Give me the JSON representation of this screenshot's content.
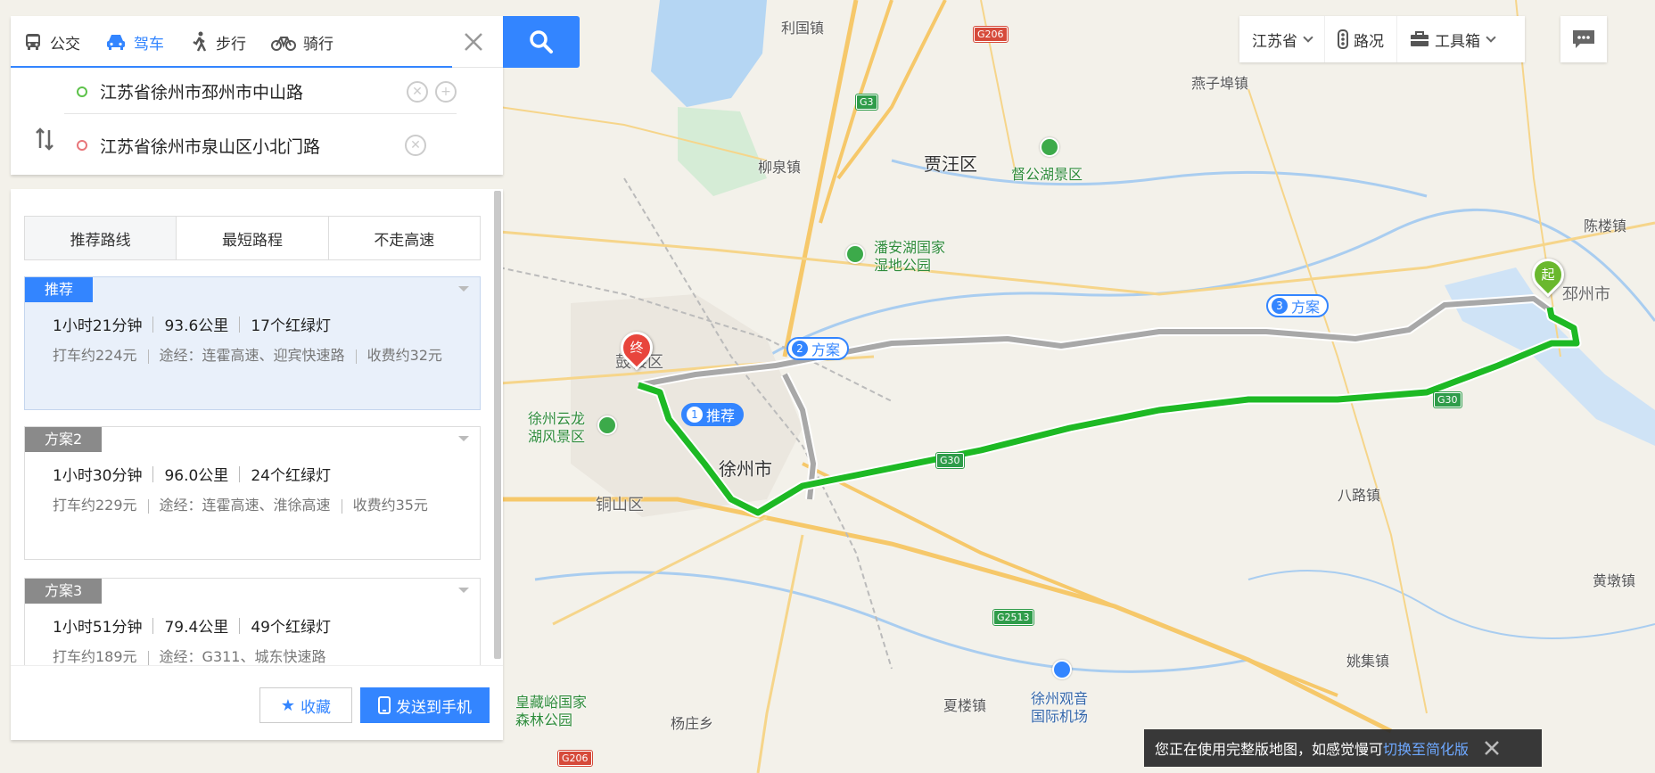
{
  "search": {
    "tabs": [
      {
        "label": "公交",
        "icon": "bus-icon"
      },
      {
        "label": "驾车",
        "icon": "car-icon"
      },
      {
        "label": "步行",
        "icon": "walk-icon"
      },
      {
        "label": "骑行",
        "icon": "bike-icon"
      }
    ],
    "active_tab": "驾车",
    "origin": "江苏省徐州市邳州市中山路",
    "destination": "江苏省徐州市泉山区小北门路"
  },
  "route_options": [
    "推荐路线",
    "最短路程",
    "不走高速"
  ],
  "plans": [
    {
      "badge": "推荐",
      "time": "1小时21分钟",
      "distance": "93.6公里",
      "lights": "17个红绿灯",
      "taxi": "打车约224元",
      "via": "途经：连霍高速、迎宾快速路",
      "toll": "收费约32元"
    },
    {
      "badge": "方案2",
      "time": "1小时30分钟",
      "distance": "96.0公里",
      "lights": "24个红绿灯",
      "taxi": "打车约229元",
      "via": "途经：连霍高速、淮徐高速",
      "toll": "收费约35元"
    },
    {
      "badge": "方案3",
      "time": "1小时51分钟",
      "distance": "79.4公里",
      "lights": "49个红绿灯",
      "taxi": "打车约189元",
      "via": "途经：G311、城东快速路",
      "toll": ""
    }
  ],
  "footer": {
    "favorite": "收藏",
    "send_phone": "发送到手机"
  },
  "toolbar": {
    "province": "江苏省",
    "traffic": "路况",
    "toolbox": "工具箱"
  },
  "notice": {
    "text": "您正在使用完整版地图，如感觉慢可",
    "link": "切换至简化版"
  },
  "map": {
    "labels": {
      "liguo": "利国镇",
      "yanzibu": "燕子埠镇",
      "liuquan": "柳泉镇",
      "jiawang": "贾汪区",
      "dugong": "督公湖景区",
      "chenlou": "陈楼镇",
      "panan1": "潘安湖国家",
      "panan2": "湿地公园",
      "pizhou": "邳州市",
      "gulou": "鼓楼区",
      "yunlong1": "徐州云龙",
      "yunlong2": "湖风景区",
      "xuzhou": "徐州市",
      "tongshan": "铜山区",
      "balu": "八路镇",
      "huangdun": "黄墩镇",
      "yaoji": "姚集镇",
      "xiaxian": "夏楼镇",
      "airport1": "徐州观音",
      "airport2": "国际机场",
      "yangzhuang": "杨庄乡",
      "huangcang1": "皇藏峪国家",
      "huangcang2": "森林公园",
      "tongshan_small": "铜山区"
    },
    "shields": {
      "g206a": "G206",
      "g3": "G3",
      "g30a": "G30",
      "g30b": "G30",
      "g2513": "G2513",
      "g206b": "G206"
    },
    "tags": {
      "rec": "推荐",
      "p2": "方案",
      "p3": "方案"
    },
    "tag_nums": {
      "rec": "1",
      "p2": "2",
      "p3": "3"
    },
    "pins": {
      "end": "终",
      "start": "起"
    }
  },
  "colors": {
    "accent": "#3385ff",
    "route_green": "#1db924",
    "route_gray": "#a8a8a8"
  }
}
